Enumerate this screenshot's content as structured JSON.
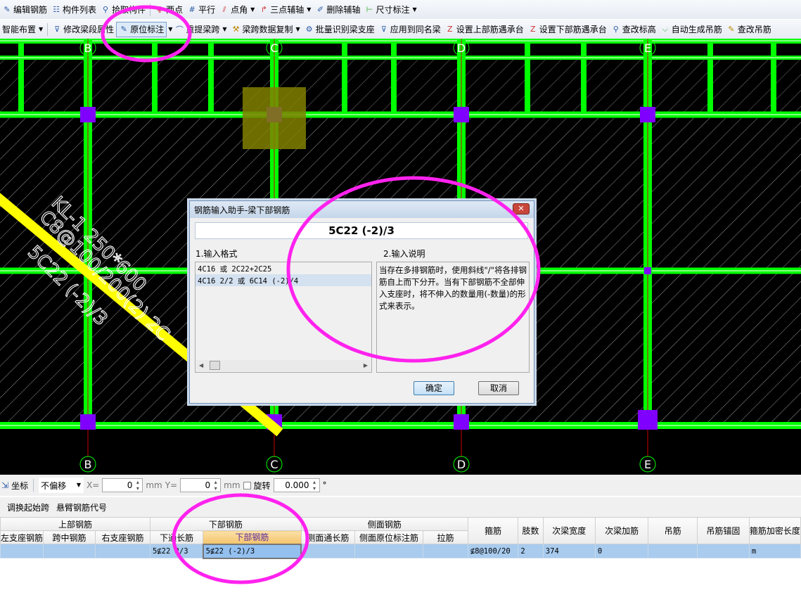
{
  "toolbar1": {
    "items": [
      {
        "icon": "edit-rebar-icon",
        "label": "编辑钢筋"
      },
      {
        "icon": "list-icon",
        "label": "构件列表"
      },
      {
        "icon": "pick-icon",
        "label": "拾取构件"
      },
      {
        "icon": "two-point-icon",
        "label": "两点"
      },
      {
        "icon": "parallel-icon",
        "label": "平行"
      },
      {
        "icon": "point-angle-icon",
        "label": "点角"
      },
      {
        "icon": "three-point-axis-icon",
        "label": "三点辅轴"
      },
      {
        "icon": "delete-axis-icon",
        "label": "删除辅轴"
      },
      {
        "icon": "dimension-icon",
        "label": "尺寸标注"
      }
    ]
  },
  "toolbar2": {
    "items": [
      {
        "icon": "",
        "label": "智能布置"
      },
      {
        "icon": "modify-icon",
        "label": "修改梁段属性"
      },
      {
        "icon": "annotate-icon",
        "label": "原位标注"
      },
      {
        "icon": "respan-icon",
        "label": "重提梁跨"
      },
      {
        "icon": "brush-icon",
        "label": "梁跨数据复制"
      },
      {
        "icon": "identify-icon",
        "label": "批量识别梁支座"
      },
      {
        "icon": "apply-icon",
        "label": "应用到同名梁"
      },
      {
        "icon": "set-top-icon",
        "label": "设置上部筋遇承台"
      },
      {
        "icon": "set-bottom-icon",
        "label": "设置下部筋遇承台"
      },
      {
        "icon": "elevation-icon",
        "label": "查改标高"
      },
      {
        "icon": "hanger-icon",
        "label": "自动生成吊筋"
      },
      {
        "icon": "edit-hanger-icon",
        "label": "查改吊筋"
      }
    ]
  },
  "canvas": {
    "axes_top": [
      "B",
      "C",
      "D",
      "E"
    ],
    "axes_bottom": [
      "B",
      "C",
      "D",
      "E"
    ],
    "beam_label": {
      "line1": "KL-1 250*600",
      "line2": "C8@100/200(2) 2C",
      "line3": "5C22 (-2)/3"
    },
    "colors": {
      "background": "#000000",
      "beam": "#00ff00",
      "column": "#8000ff",
      "selection": "#ffff00",
      "annotation": "#ff22ee"
    }
  },
  "dialog": {
    "title": "钢筋输入助手-梁下部钢筋",
    "formula": "5C22 (-2)/3",
    "format_label": "1.输入格式",
    "formats": [
      "4C16 或 2C22+2C25",
      "4C16 2/2 或 6C14 (-2)/4"
    ],
    "desc_label": "2.输入说明",
    "description": "当存在多排钢筋时，使用斜线\"/\"将各排钢筋自上而下分开。当有下部钢筋不全部伸入支座时，将不伸入的数量用(-数量)的形式来表示。",
    "ok": "确定",
    "cancel": "取消"
  },
  "coord_bar": {
    "label": "坐标",
    "offset_mode": "不偏移",
    "x_label": "X=",
    "x_value": "0",
    "unit": "mm",
    "y_label": "Y=",
    "y_value": "0",
    "rotate_label": "旋转",
    "rotate_value": "0.000",
    "degree": "°"
  },
  "toolbar3": {
    "items": [
      "调换起始跨",
      "悬臂钢筋代号"
    ]
  },
  "table": {
    "groups": [
      "上部钢筋",
      "下部钢筋",
      "侧面钢筋"
    ],
    "columns": [
      "左支座钢筋",
      "跨中钢筋",
      "右支座钢筋",
      "下通长筋",
      "下部钢筋",
      "侧面通长筋",
      "侧面原位标注筋",
      "拉筋",
      "箍筋",
      "肢数",
      "次梁宽度",
      "次梁加筋",
      "吊筋",
      "吊筋锚固",
      "箍筋加密长度"
    ],
    "row": [
      "",
      "",
      "",
      "5⊈22 2/3",
      "5⊈22 (-2)/3",
      "",
      "",
      "",
      "⊈8@100/20",
      "2",
      "374",
      "0",
      "",
      "",
      "m"
    ]
  }
}
